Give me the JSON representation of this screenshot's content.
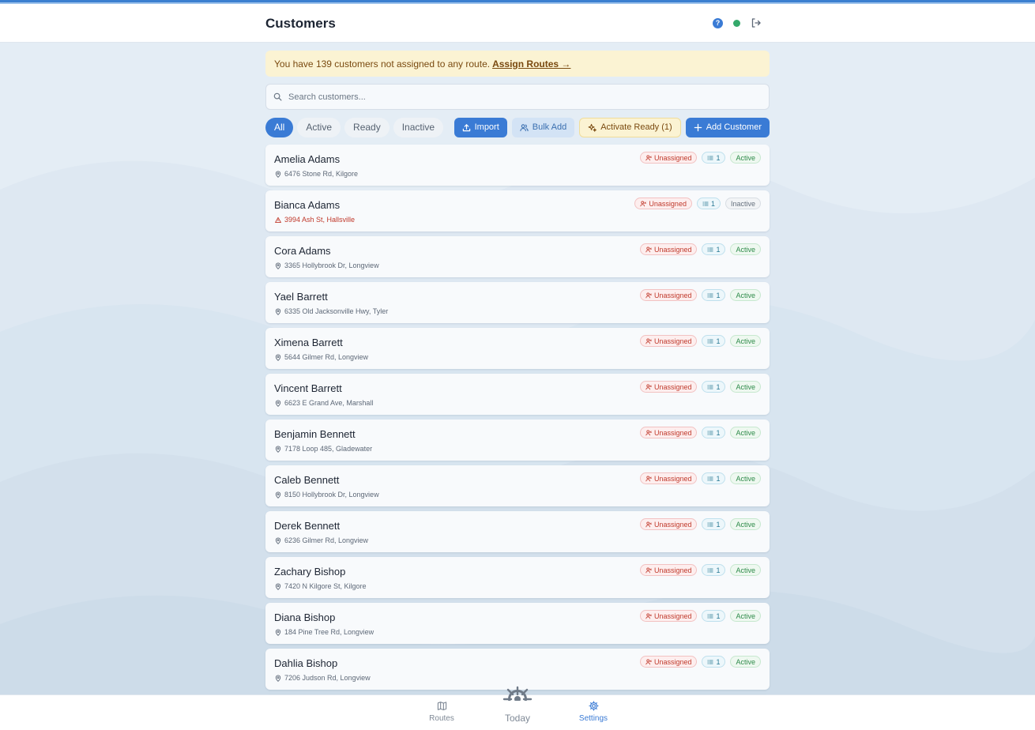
{
  "header": {
    "title": "Customers"
  },
  "banner": {
    "text": "You have 139 customers not assigned to any route.",
    "link": "Assign Routes →"
  },
  "search": {
    "placeholder": "Search customers..."
  },
  "filters": [
    {
      "label": "All",
      "active": true
    },
    {
      "label": "Active",
      "active": false
    },
    {
      "label": "Ready",
      "active": false
    },
    {
      "label": "Inactive",
      "active": false
    }
  ],
  "actions": {
    "import": "Import",
    "bulk_add": "Bulk Add",
    "activate_ready": "Activate Ready (1)",
    "add_customer": "Add Customer"
  },
  "customers": [
    {
      "name": "Amelia Adams",
      "address": "6476 Stone Rd, Kilgore",
      "route": "Unassigned",
      "count": "1",
      "status": "Active",
      "address_warning": false
    },
    {
      "name": "Bianca Adams",
      "address": "3994 Ash St, Hallsville",
      "route": "Unassigned",
      "count": "1",
      "status": "Inactive",
      "address_warning": true
    },
    {
      "name": "Cora Adams",
      "address": "3365 Hollybrook Dr, Longview",
      "route": "Unassigned",
      "count": "1",
      "status": "Active",
      "address_warning": false
    },
    {
      "name": "Yael Barrett",
      "address": "6335 Old Jacksonville Hwy, Tyler",
      "route": "Unassigned",
      "count": "1",
      "status": "Active",
      "address_warning": false
    },
    {
      "name": "Ximena Barrett",
      "address": "5644 Gilmer Rd, Longview",
      "route": "Unassigned",
      "count": "1",
      "status": "Active",
      "address_warning": false
    },
    {
      "name": "Vincent Barrett",
      "address": "6623 E Grand Ave, Marshall",
      "route": "Unassigned",
      "count": "1",
      "status": "Active",
      "address_warning": false
    },
    {
      "name": "Benjamin Bennett",
      "address": "7178 Loop 485, Gladewater",
      "route": "Unassigned",
      "count": "1",
      "status": "Active",
      "address_warning": false
    },
    {
      "name": "Caleb Bennett",
      "address": "8150 Hollybrook Dr, Longview",
      "route": "Unassigned",
      "count": "1",
      "status": "Active",
      "address_warning": false
    },
    {
      "name": "Derek Bennett",
      "address": "6236 Gilmer Rd, Longview",
      "route": "Unassigned",
      "count": "1",
      "status": "Active",
      "address_warning": false
    },
    {
      "name": "Zachary Bishop",
      "address": "7420 N Kilgore St, Kilgore",
      "route": "Unassigned",
      "count": "1",
      "status": "Active",
      "address_warning": false
    },
    {
      "name": "Diana Bishop",
      "address": "184 Pine Tree Rd, Longview",
      "route": "Unassigned",
      "count": "1",
      "status": "Active",
      "address_warning": false
    },
    {
      "name": "Dahlia Bishop",
      "address": "7206 Judson Rd, Longview",
      "route": "Unassigned",
      "count": "1",
      "status": "Active",
      "address_warning": false
    }
  ],
  "nav": {
    "routes": "Routes",
    "today": "Today",
    "settings": "Settings"
  },
  "colors": {
    "accent": "#3a7bd5",
    "unassigned": "#c0392b",
    "active": "#2e8b4a",
    "banner_bg": "#fbf3d3"
  }
}
